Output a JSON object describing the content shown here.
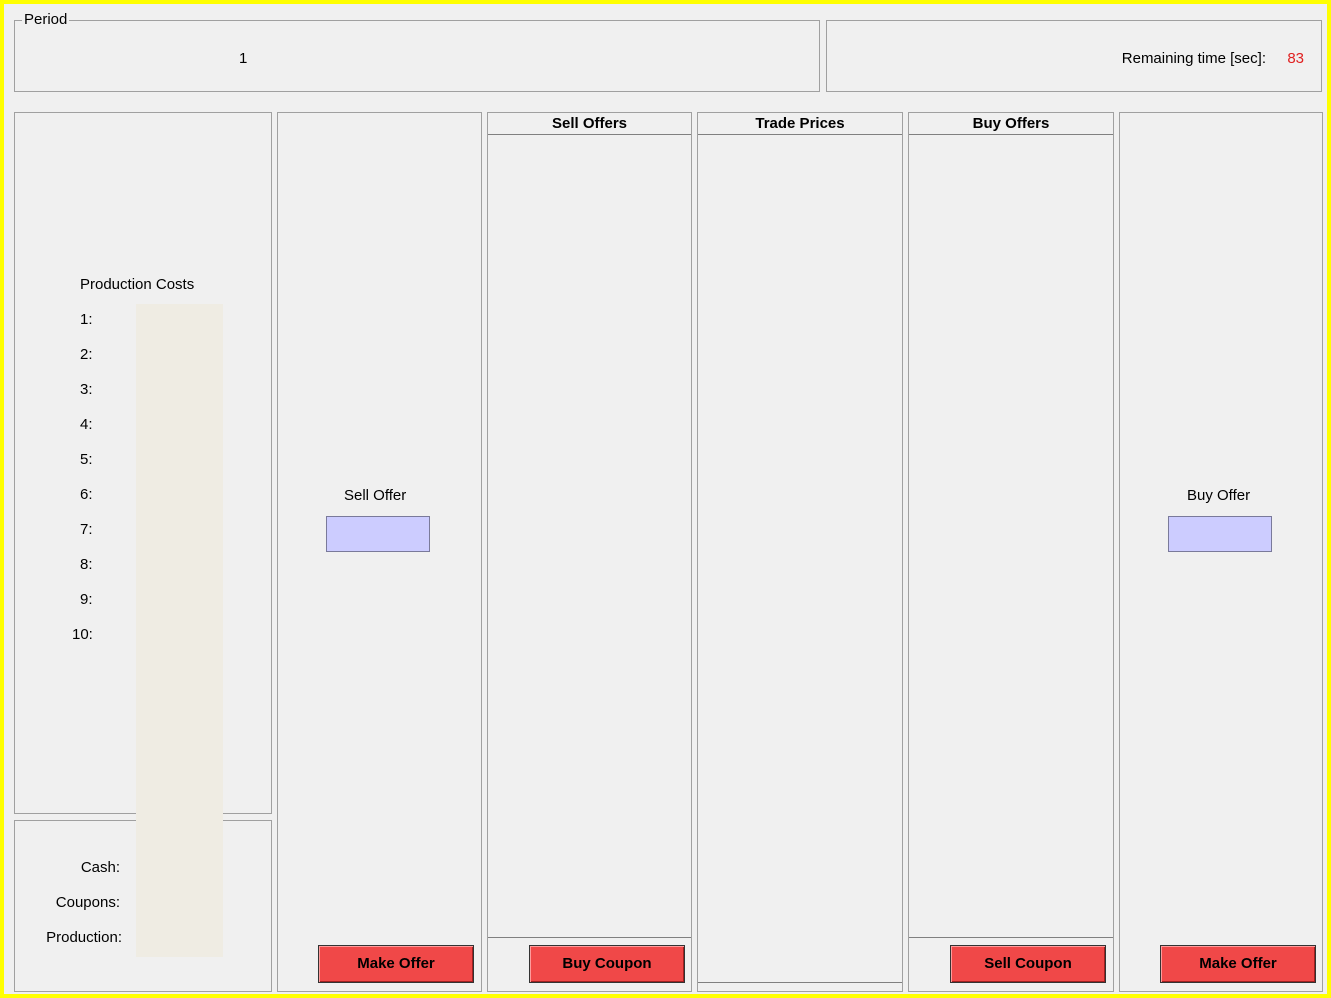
{
  "period": {
    "legend": "Period",
    "value": "1"
  },
  "timer": {
    "label": "Remaining time [sec]:",
    "value": "83",
    "value_color": "#e02020"
  },
  "production_costs": {
    "title": "Production Costs",
    "rows": [
      "1:",
      "2:",
      "3:",
      "4:",
      "5:",
      "6:",
      "7:",
      "8:",
      "9:",
      "10:"
    ]
  },
  "account": {
    "cash_label": "Cash:",
    "coupons_label": "Coupons:",
    "production_label": "Production:"
  },
  "sell_offer": {
    "label": "Sell Offer",
    "button": "Make Offer"
  },
  "sell_offers": {
    "header": "Sell Offers",
    "button": "Buy Coupon"
  },
  "trade_prices": {
    "header": "Trade Prices"
  },
  "buy_offers": {
    "header": "Buy Offers",
    "button": "Sell Coupon"
  },
  "buy_offer": {
    "label": "Buy Offer",
    "button": "Make Offer"
  },
  "colors": {
    "border": "#ffff00",
    "button": "#f04848",
    "input": "#ccccff"
  }
}
